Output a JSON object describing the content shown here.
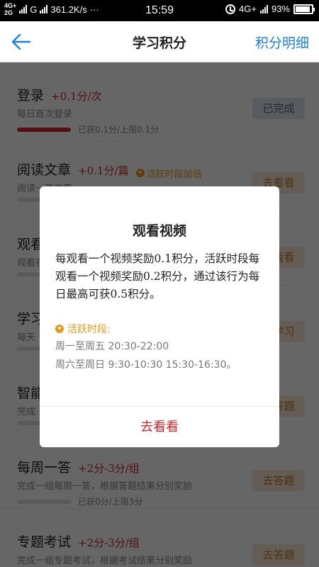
{
  "status_bar": {
    "network_top": "4G+",
    "network_bottom": "2G",
    "carrier_g": "G",
    "speed": "361.2K/s",
    "more": "···",
    "time": "15:59",
    "network_right": "4G+",
    "battery_percent": "93%",
    "battery_level": 0.93
  },
  "navbar": {
    "back_icon": "arrow-left-icon",
    "title": "学习积分",
    "action_label": "积分明细",
    "accent_color": "#1e7fd8"
  },
  "tasks": [
    {
      "title": "登录",
      "points": "+0.1分/次",
      "desc": "每日首次登录",
      "progress_text": "已获0.1分/上限0.1分",
      "progress_fraction": 1.0,
      "button_label": "已完成",
      "button_state": "done"
    },
    {
      "title": "阅读文章",
      "points": "+0.1分/篇",
      "boost_label": "活跃时段加倍",
      "desc": "阅读一篇文章",
      "progress_text": "",
      "progress_fraction": 0,
      "button_label": "去看看",
      "button_state": "go"
    },
    {
      "title": "观看视频",
      "points": "",
      "desc": "观看视频",
      "progress_text": "",
      "progress_fraction": 0,
      "button_label": "去看看",
      "button_state": "go"
    },
    {
      "title": "学习时长",
      "points": "",
      "desc": "每天",
      "progress_text": "",
      "progress_fraction": 0,
      "button_label": "去学习",
      "button_state": "go"
    },
    {
      "title": "智能答题",
      "points": "",
      "desc": "完成",
      "progress_text": "",
      "progress_fraction": 0,
      "button_label": "去答题",
      "button_state": "go"
    },
    {
      "title": "每周一答",
      "points": "+2分-3分/组",
      "desc": "完成一组每周一答，根据答题结果分别奖励",
      "progress_text": "已获0分/上限3分",
      "progress_fraction": 0,
      "button_label": "去答题",
      "button_state": "go"
    },
    {
      "title": "专题考试",
      "points": "+2分-3分/组",
      "desc": "完成一组专题考试，根据考试结果分别奖励",
      "progress_text": "",
      "progress_fraction": 0,
      "button_label": "去答题",
      "button_state": "go"
    }
  ],
  "dialog": {
    "title": "观看视频",
    "body": "每观看一个视频奖励0.1积分，活跃时段每观看一个视频奖励0.2积分，通过该行为每日最高可获0.5积分。",
    "active_label": "活跃时段:",
    "active_times": [
      "周一至周五  20:30-22:00",
      "周六至周日  9:30-10:30  15:30-16:30。"
    ],
    "button_label": "去看看",
    "accent_color": "#d0282e",
    "active_color": "#e59a1c"
  }
}
